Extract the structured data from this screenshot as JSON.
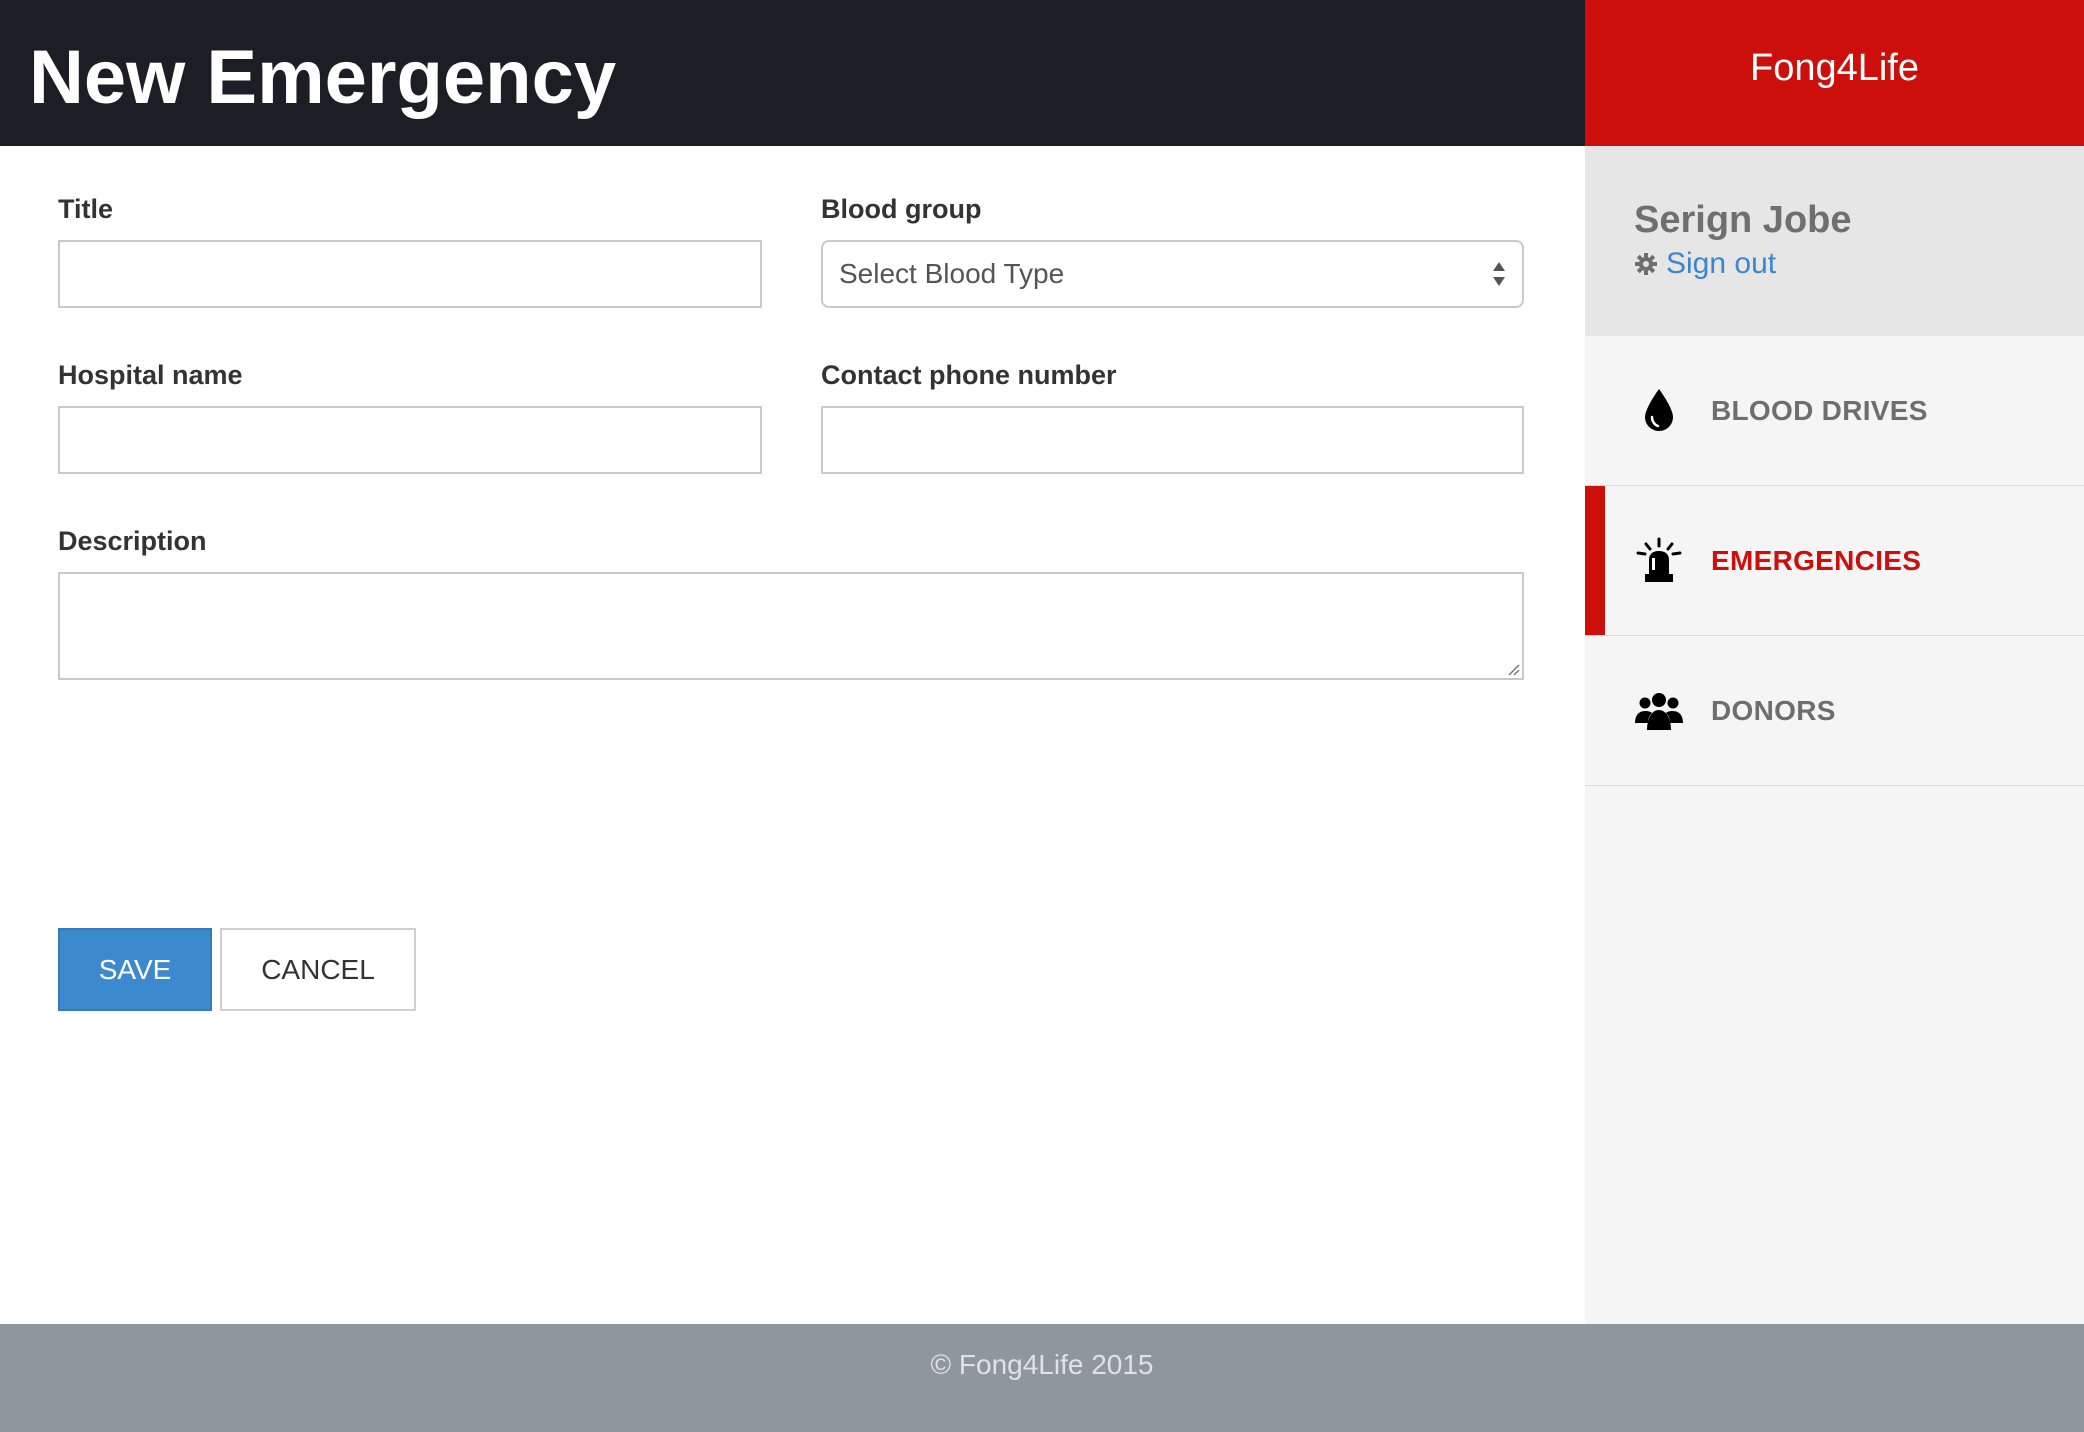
{
  "header": {
    "title": "New Emergency"
  },
  "brand": {
    "name": "Fong4Life"
  },
  "user": {
    "name": "Serign Jobe",
    "signout_label": "Sign out",
    "signout_icon": "gear-icon"
  },
  "nav": {
    "items": [
      {
        "label": "BLOOD DRIVES",
        "icon": "blood-drop-icon",
        "active": false
      },
      {
        "label": "EMERGENCIES",
        "icon": "siren-icon",
        "active": true
      },
      {
        "label": "DONORS",
        "icon": "people-icon",
        "active": false
      }
    ]
  },
  "form": {
    "title_label": "Title",
    "title_value": "",
    "blood_group_label": "Blood group",
    "blood_group_value": "Select Blood Type",
    "hospital_label": "Hospital name",
    "hospital_value": "",
    "phone_label": "Contact phone number",
    "phone_value": "",
    "description_label": "Description",
    "description_value": ""
  },
  "buttons": {
    "save_label": "SAVE",
    "cancel_label": "CANCEL"
  },
  "footer": {
    "text": "© Fong4Life 2015"
  },
  "colors": {
    "accent": "#cc0f0a",
    "primary_button": "#3d89cd",
    "header_bg": "#1b1e25",
    "footer_bg": "#8d979d",
    "link": "#3b86cf"
  }
}
